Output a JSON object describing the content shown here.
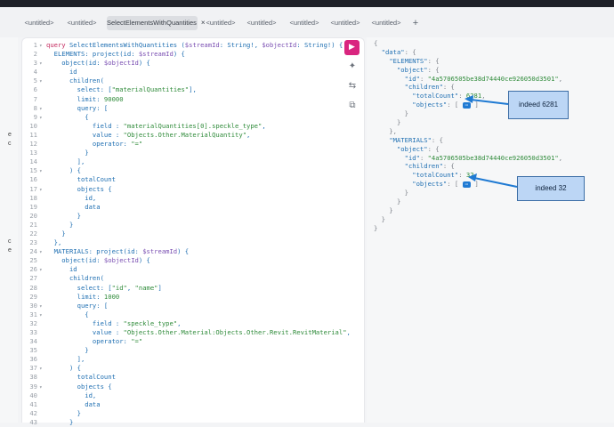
{
  "tabs": [
    {
      "label": "<untitled>"
    },
    {
      "label": "<untitled>"
    },
    {
      "label": "SelectElementsWithQuantities",
      "active": true,
      "close": "×"
    },
    {
      "label": "<untitled>"
    },
    {
      "label": "<untitled>"
    },
    {
      "label": "<untitled>"
    },
    {
      "label": "<untitled>"
    },
    {
      "label": "<untitled>"
    }
  ],
  "add_tab_label": "+",
  "left_strip": [
    "e",
    "c",
    "c",
    "e"
  ],
  "query_lines": [
    "query SelectElementsWithQuantities ($streamId: String!, $objectId: String!) {",
    "  ELEMENTS: project(id: $streamId) {",
    "    object(id: $objectId) {",
    "      id",
    "      children(",
    "        select: [\"materialQuantities\"],",
    "        limit: 90000",
    "        query: [",
    "          {",
    "            field : \"materialQuantities[0].speckle_type\",",
    "            value : \"Objects.Other.MaterialQuantity\",",
    "            operator: \"=\"",
    "          }",
    "        ],",
    "      ) {",
    "        totalCount",
    "        objects {",
    "          id,",
    "          data",
    "        }",
    "      }",
    "    }",
    "  },",
    "  MATERIALS: project(id: $streamId) {",
    "    object(id: $objectId) {",
    "      id",
    "      children(",
    "        select: [\"id\", \"name\"]",
    "        limit: 1000",
    "        query: [",
    "          {",
    "            field : \"speckle_type\",",
    "            value : \"Objects.Other.Material:Objects.Other.Revit.RevitMaterial\",",
    "            operator: \"=\"",
    "          }",
    "        ],",
    "      ) {",
    "        totalCount",
    "        objects {",
    "          id,",
    "          data",
    "        }",
    "      }"
  ],
  "fold_lines": [
    1,
    3,
    5,
    8,
    9,
    15,
    17,
    24,
    26,
    30,
    31,
    37,
    39
  ],
  "result_lines": [
    "{",
    "  \"data\": {",
    "    \"ELEMENTS\": {",
    "      \"object\": {",
    "        \"id\": \"4a5706505be38d74440ce926050d3501\",",
    "        \"children\": {",
    "          \"totalCount\": 6281,",
    "          \"objects\": [ ",
    "        }",
    "      }",
    "    },",
    "    \"MATERIALS\": {",
    "      \"object\": {",
    "        \"id\": \"4a5706505be38d74440ce926050d3501\",",
    "        \"children\": {",
    "          \"totalCount\": 32,",
    "          \"objects\": [ ",
    "        }",
    "      }",
    "    }",
    "  }",
    "}"
  ],
  "result_pill": "⋯",
  "annotations": [
    {
      "text": "indeed 6281"
    },
    {
      "text": "indeed 32"
    }
  ],
  "toolbar": {
    "run_icon": "▶",
    "prettify_icon": "✦",
    "merge_icon": "⇆",
    "copy_icon": "⧉"
  },
  "colors": {
    "run_button": "#d9257f",
    "arrow": "#1f7ad3"
  }
}
